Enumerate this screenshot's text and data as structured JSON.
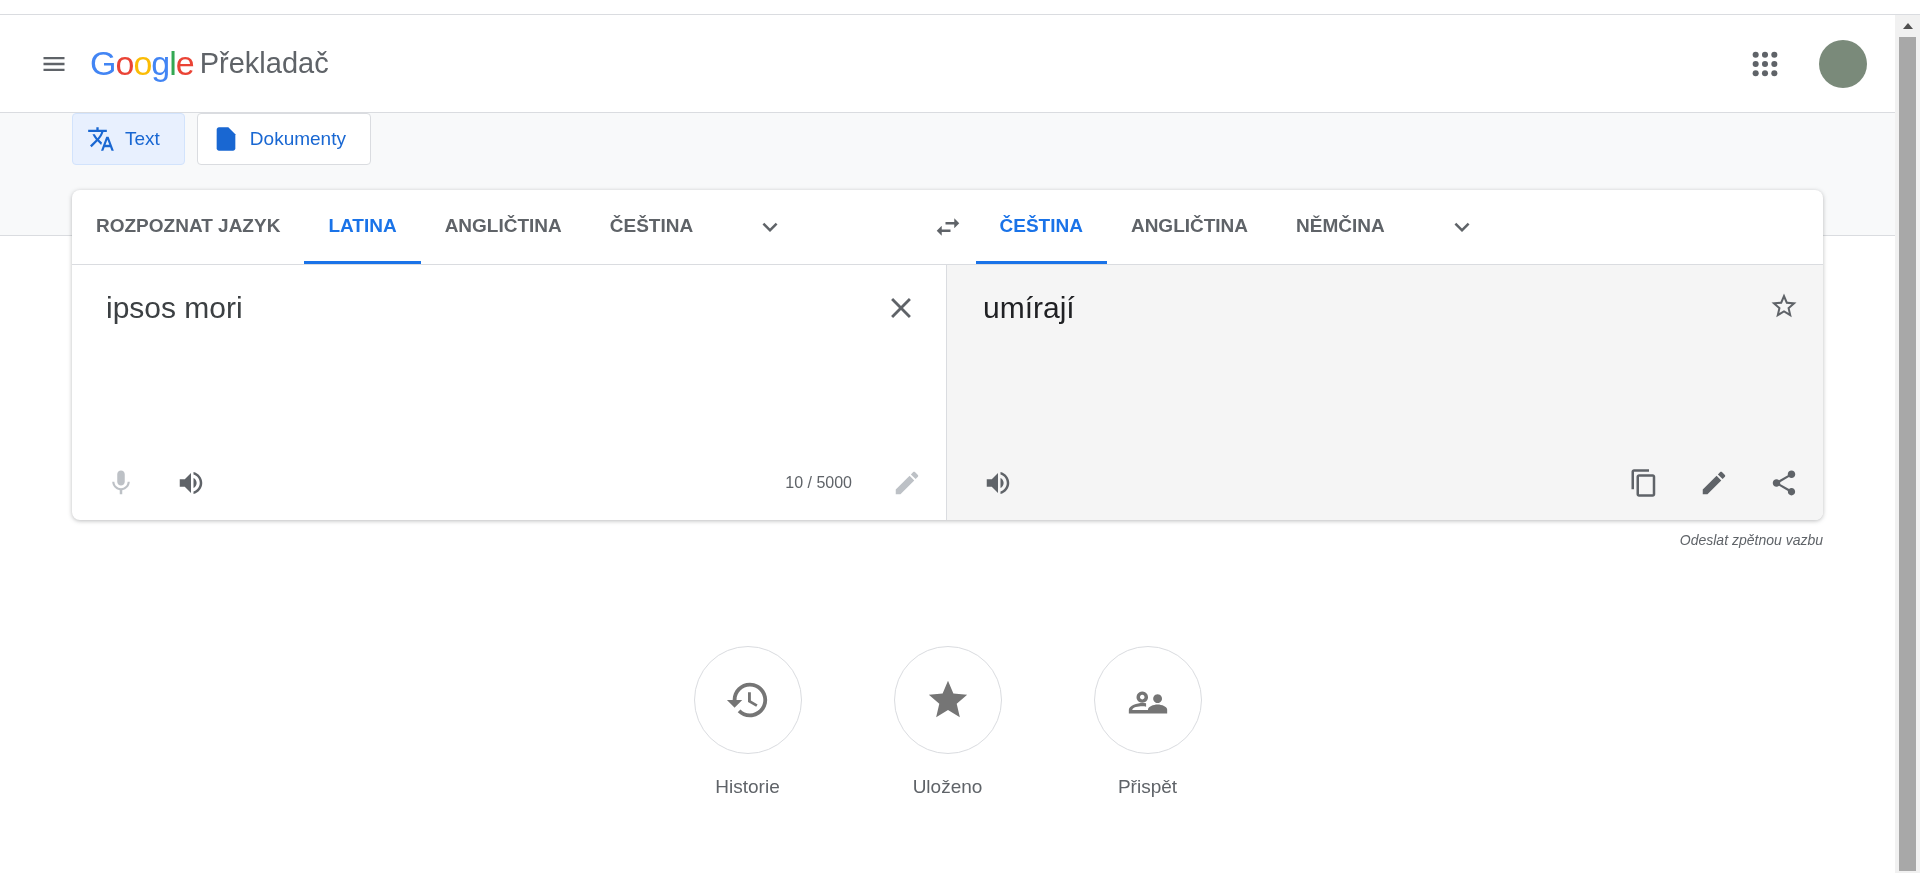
{
  "header": {
    "logo": "Google",
    "product": "Překladač"
  },
  "mode_tabs": [
    {
      "label": "Text",
      "selected": true,
      "kind": "text"
    },
    {
      "label": "Dokumenty",
      "selected": false,
      "kind": "document"
    }
  ],
  "source": {
    "languages": [
      {
        "label": "ROZPOZNAT JAZYK",
        "selected": false
      },
      {
        "label": "LATINA",
        "selected": true
      },
      {
        "label": "ANGLIČTINA",
        "selected": false
      },
      {
        "label": "ČEŠTINA",
        "selected": false
      }
    ],
    "text": "ipsos mori",
    "counter": "10 / 5000"
  },
  "target": {
    "languages": [
      {
        "label": "ČEŠTINA",
        "selected": true
      },
      {
        "label": "ANGLIČTINA",
        "selected": false
      },
      {
        "label": "NĚMČINA",
        "selected": false
      }
    ],
    "text": "umírají"
  },
  "feedback": "Odeslat zpětnou vazbu",
  "shortcuts": [
    {
      "label": "Historie",
      "kind": "history"
    },
    {
      "label": "Uloženo",
      "kind": "saved"
    },
    {
      "label": "Přispět",
      "kind": "contribute"
    }
  ]
}
